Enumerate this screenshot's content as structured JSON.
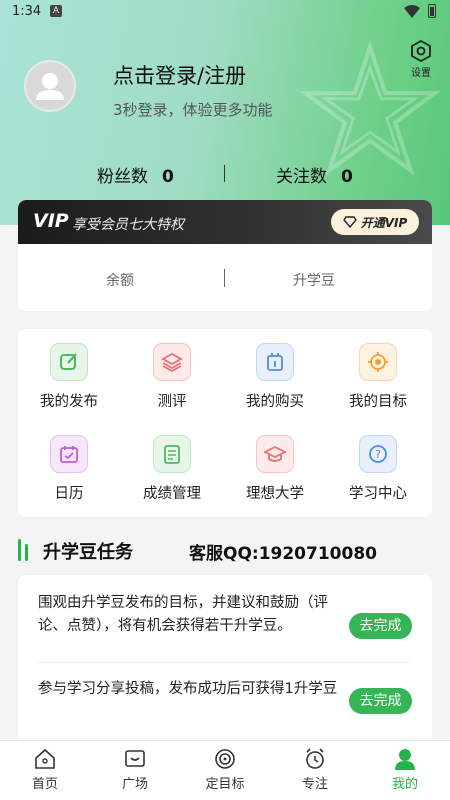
{
  "status": {
    "time": "1:34",
    "notif_icon": "A"
  },
  "header": {
    "settings_label": "设置",
    "login_title": "点击登录/注册",
    "login_sub": "3秒登录，体验更多功能"
  },
  "stats": {
    "fans_label": "粉丝数",
    "fans_value": "0",
    "follow_label": "关注数",
    "follow_value": "0"
  },
  "vip": {
    "logo": "VIP",
    "text": "享受会员七大特权",
    "button": "开通VIP",
    "balance_label": "余额",
    "beans_label": "升学豆"
  },
  "menu": {
    "items": [
      {
        "label": "我的发布",
        "icon": "edit-icon",
        "color": "#4cbb5e"
      },
      {
        "label": "测评",
        "icon": "layers-icon",
        "color": "#ef6e6e"
      },
      {
        "label": "我的购买",
        "icon": "purchase-icon",
        "color": "#4a8fe0"
      },
      {
        "label": "我的目标",
        "icon": "target-icon",
        "color": "#f0a32c"
      },
      {
        "label": "日历",
        "icon": "calendar-icon",
        "color": "#c458d8"
      },
      {
        "label": "成绩管理",
        "icon": "score-icon",
        "color": "#4cbb5e"
      },
      {
        "label": "理想大学",
        "icon": "graduation-icon",
        "color": "#ef6e6e"
      },
      {
        "label": "学习中心",
        "icon": "help-icon",
        "color": "#4a8fe0"
      }
    ]
  },
  "tasks": {
    "title": "升学豆任务",
    "service": "客服QQ:1920710080",
    "items": [
      {
        "text": "围观由升学豆发布的目标，并建议和鼓励（评论、点赞），将有机会获得若干升学豆。",
        "button": "去完成"
      },
      {
        "text": "参与学习分享投稿，发布成功后可获得1升学豆",
        "button": "去完成"
      }
    ]
  },
  "tabs": [
    {
      "label": "首页",
      "icon": "home-icon"
    },
    {
      "label": "广场",
      "icon": "square-icon"
    },
    {
      "label": "定目标",
      "icon": "goal-icon"
    },
    {
      "label": "专注",
      "icon": "alarm-icon"
    },
    {
      "label": "我的",
      "icon": "user-icon",
      "active": true
    }
  ],
  "colors": {
    "accent": "#22b44a",
    "header_start": "#a9e3d8",
    "header_end": "#58c879"
  }
}
